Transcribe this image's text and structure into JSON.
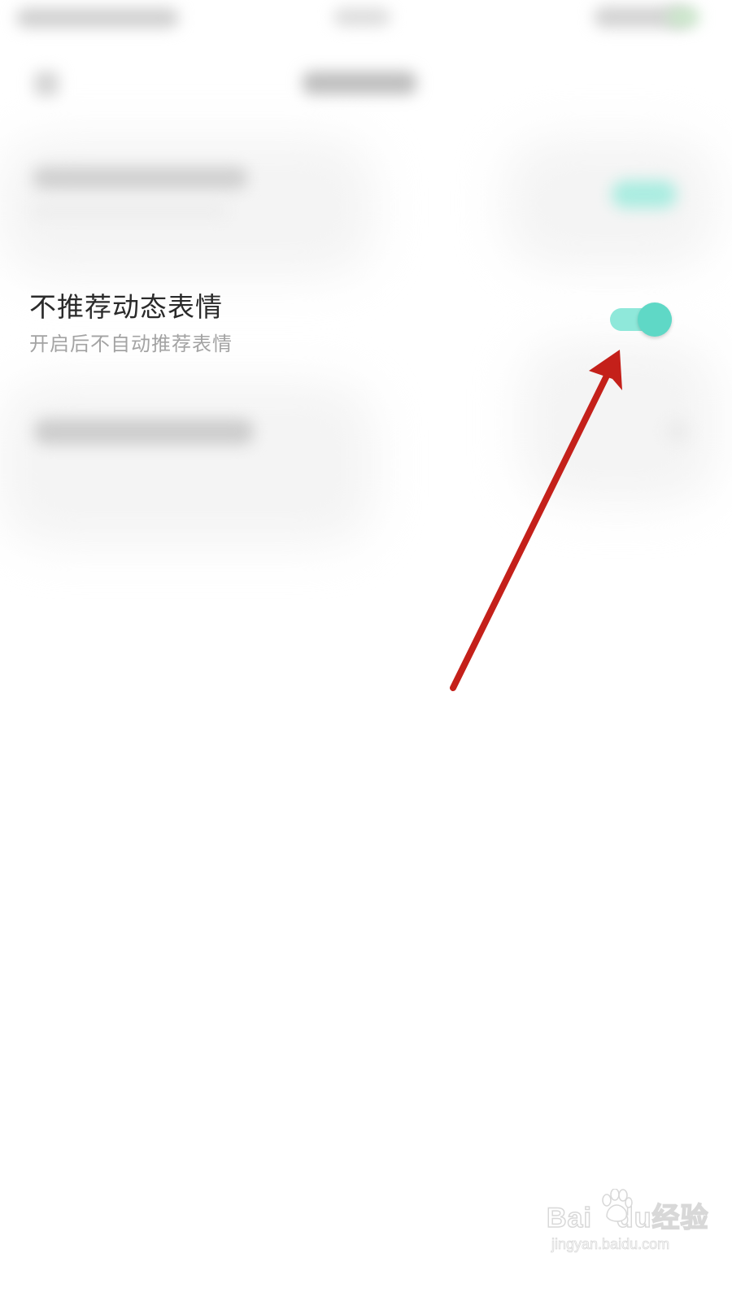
{
  "setting": {
    "title": "不推荐动态表情",
    "subtitle": "开启后不自动推荐表情",
    "toggle_on": true
  },
  "colors": {
    "toggle_track": "#8fe8da",
    "toggle_knob": "#5fd8c6",
    "arrow": "#c4201a",
    "title_text": "#2a2a2a",
    "subtitle_text": "#a3a3a3"
  },
  "watermark": {
    "logo": "Baidu经验",
    "url": "jingyan.baidu.com"
  }
}
